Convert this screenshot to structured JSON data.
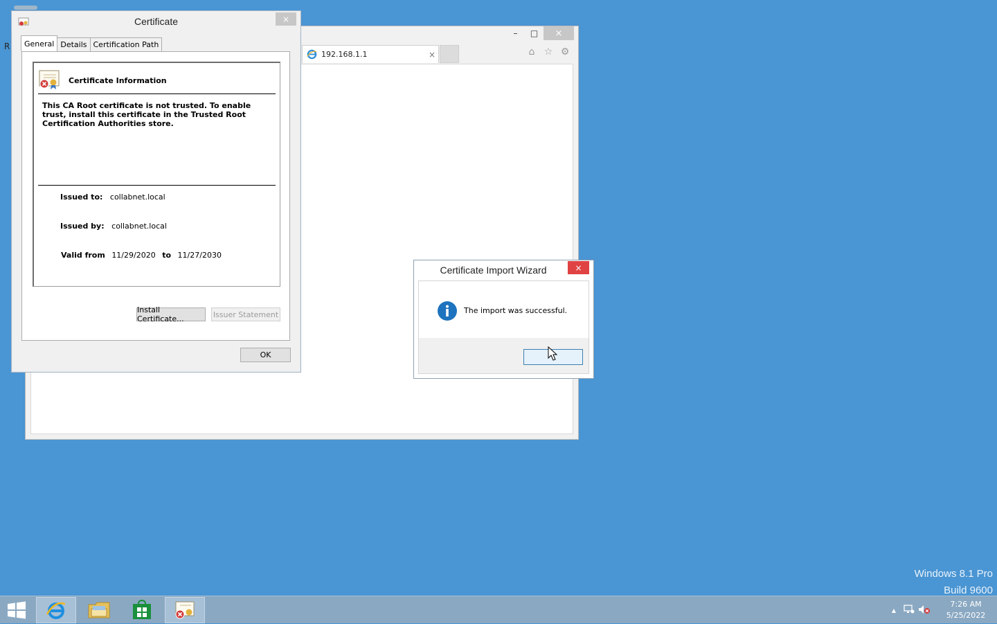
{
  "desktop": {
    "icon_fragment_label": "R",
    "watermark": {
      "line1": "Windows 8.1 Pro",
      "line2": "Build 9600"
    }
  },
  "browser": {
    "tab_title": "192.168.1.1",
    "tab_close": "×",
    "window_buttons": {
      "minimize": "–",
      "maximize": "□",
      "close": "×"
    }
  },
  "certificate_dialog": {
    "title": "Certificate",
    "close": "×",
    "tabs": [
      "General",
      "Details",
      "Certification Path"
    ],
    "heading": "Certificate Information",
    "message": "This CA Root certificate is not trusted. To enable trust, install this certificate in the Trusted Root Certification Authorities store.",
    "issued_to_label": "Issued to:",
    "issued_to_value": "collabnet.local",
    "issued_by_label": "Issued by:",
    "issued_by_value": "collabnet.local",
    "valid_from_label": "Valid from",
    "valid_from_value": "11/29/2020",
    "valid_to_label": "to",
    "valid_to_value": "11/27/2030",
    "install_button": "Install Certificate...",
    "issuer_statement_button": "Issuer Statement",
    "ok_button": "OK"
  },
  "import_wizard": {
    "title": "Certificate Import Wizard",
    "close": "×",
    "message": "The import was successful.",
    "ok_button": ""
  },
  "taskbar": {
    "clock_time": "7:26 AM",
    "clock_date": "5/25/2022",
    "tray_arrow": "▲"
  },
  "colors": {
    "desktop": "#4a95d3",
    "taskbar": "#8aa8c2",
    "wizard_close": "#e04343",
    "info_blue": "#1e73be"
  }
}
